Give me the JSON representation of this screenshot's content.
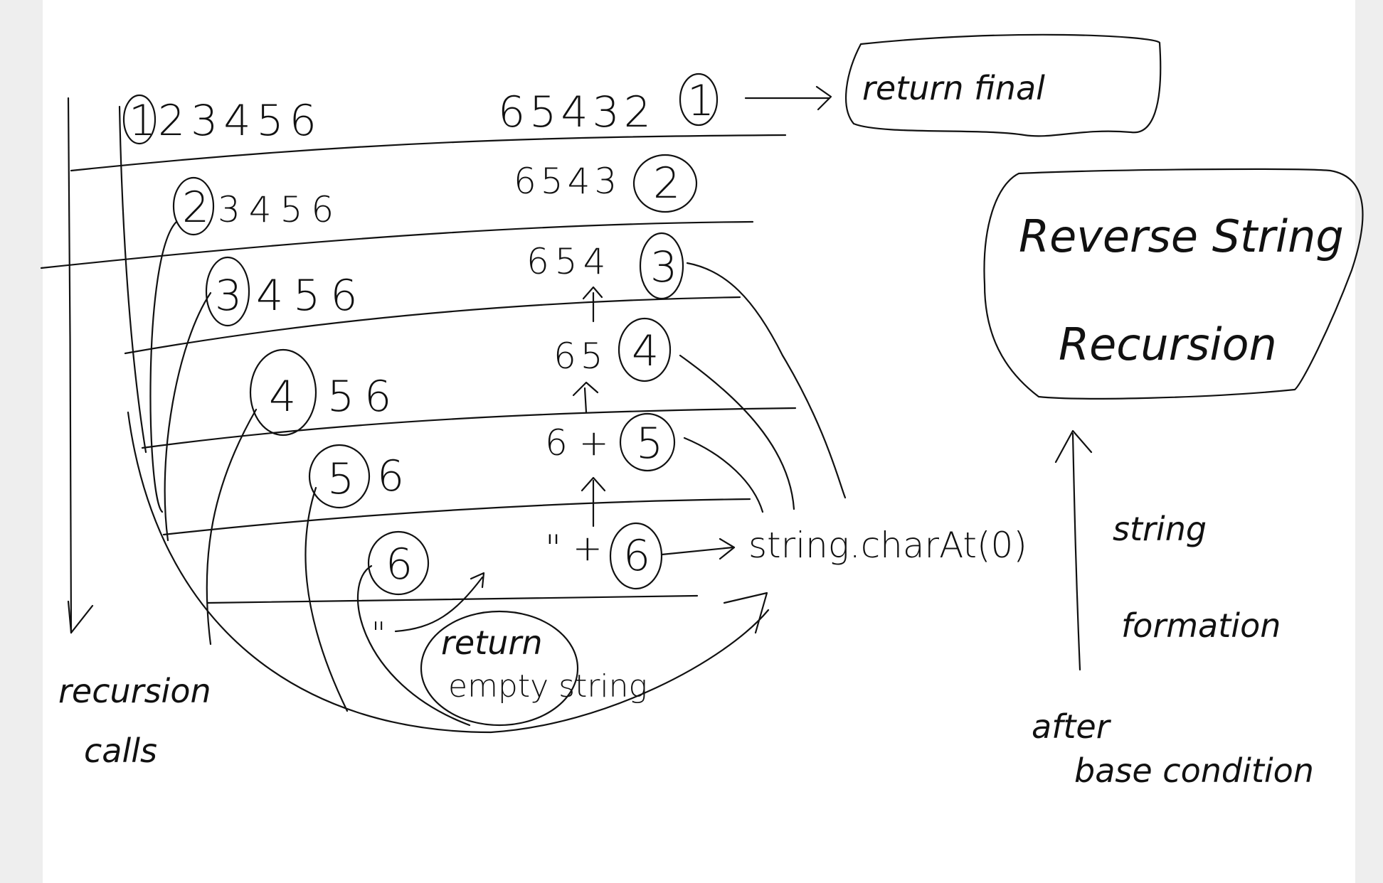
{
  "diagram": {
    "title": {
      "line1": "Reverse String",
      "line2": "Recursion"
    },
    "left_column": {
      "rows": [
        {
          "circled": "1",
          "rest": "23456"
        },
        {
          "circled": "2",
          "rest": "3456"
        },
        {
          "circled": "3",
          "rest": "456"
        },
        {
          "circled": "4",
          "rest": "56"
        },
        {
          "circled": "5",
          "rest": "6"
        },
        {
          "circled": "6",
          "rest": ""
        }
      ],
      "base_value": "\"",
      "base_note": {
        "line1": "return",
        "line2": "empty string"
      }
    },
    "right_column": {
      "rows": [
        {
          "prefix": "65432",
          "circled": "1"
        },
        {
          "prefix": "6543",
          "circled": "2"
        },
        {
          "prefix": "654",
          "circled": "3"
        },
        {
          "prefix": "65",
          "circled": "4"
        },
        {
          "prefix": "6 +",
          "circled": "5"
        },
        {
          "prefix": "\" +",
          "circled": "6"
        }
      ]
    },
    "labels": {
      "return_final": "return final",
      "char_at": "string.charAt(0)",
      "recursion_calls": {
        "line1": "recursion",
        "line2": "calls"
      },
      "string_formation": {
        "line1": "string",
        "line2": "formation"
      },
      "after_base": {
        "line1": "after",
        "line2": "base condition"
      }
    }
  }
}
